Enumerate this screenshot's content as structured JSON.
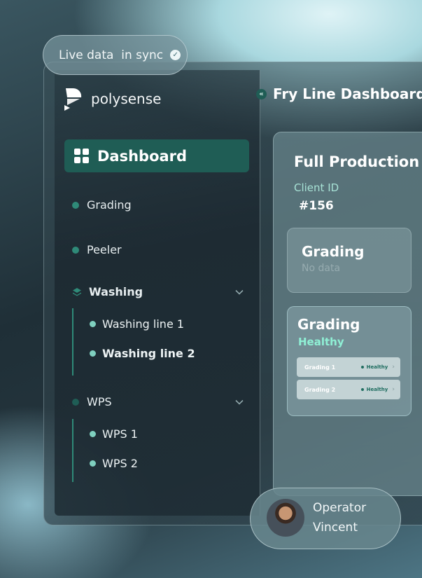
{
  "sync_badge": {
    "label": "Live data  in sync",
    "icon": "check-circle-icon"
  },
  "brand": {
    "name": "polysense",
    "icon": "polysense-logo-icon"
  },
  "sidebar": {
    "active_item": {
      "label": "Dashboard",
      "icon": "grid-icon"
    },
    "items": [
      {
        "label": "Grading",
        "icon": "dot-icon"
      },
      {
        "label": "Peeler",
        "icon": "dot-icon"
      }
    ],
    "groups": [
      {
        "label": "Washing",
        "icon": "layers-icon",
        "expanded": true,
        "children": [
          {
            "label": "Washing line 1"
          },
          {
            "label": "Washing line 2"
          }
        ]
      },
      {
        "label": "WPS",
        "icon": "dot-icon",
        "expanded": true,
        "children": [
          {
            "label": "WPS 1"
          },
          {
            "label": "WPS 2"
          }
        ]
      }
    ]
  },
  "header": {
    "title": "Fry Line Dashboard",
    "collapse_icon": "chevrons-left-icon"
  },
  "main": {
    "title": "Full Production",
    "client_label": "Client ID",
    "client_id": "#156",
    "cards": [
      {
        "title": "Grading",
        "subtitle": "No data"
      },
      {
        "title": "Grading",
        "status": "Healthy",
        "rows": [
          {
            "label": "Grading 1",
            "status": "Healthy"
          },
          {
            "label": "Grading 2",
            "status": "Healthy"
          }
        ]
      }
    ]
  },
  "operator": {
    "role": "Operator",
    "name": "Vincent"
  },
  "colors": {
    "accent": "#1f5d55",
    "healthy": "#8ff0d5",
    "dot": "#2f8a78"
  }
}
